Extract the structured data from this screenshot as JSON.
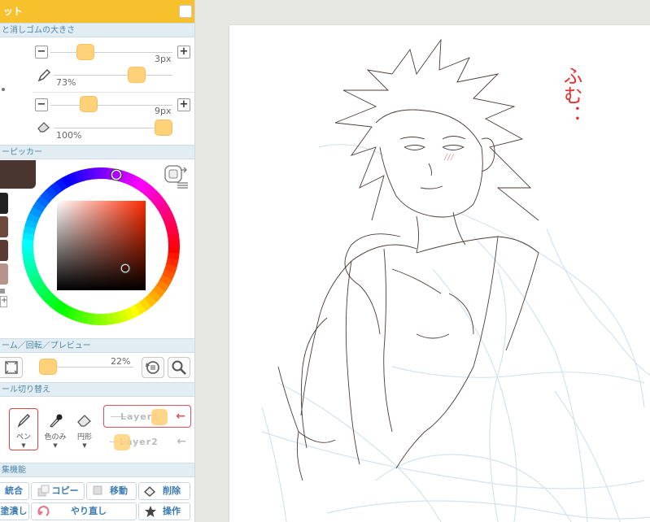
{
  "panel": {
    "title": "ット",
    "sections": {
      "brush": "と消しゴムの大きさ",
      "color": "ーピッカー",
      "zoom": "ーム／回転／プレビュー",
      "tools": "ール切り替え",
      "edit": "集機能"
    },
    "pen": {
      "size_value": "3px",
      "size_level": 0.25,
      "opacity_value": "73%",
      "opacity_level": 0.73
    },
    "eraser": {
      "size_value": "9px",
      "size_level": 0.28,
      "opacity_value": "100%",
      "opacity_level": 1.0
    },
    "zoom": {
      "value": "22%",
      "level": 0.05
    },
    "colors": {
      "current": "#4a3630",
      "swatches": [
        "#222222",
        "#6d4a3c",
        "#5a3a33",
        "#b7938c"
      ]
    },
    "tools": [
      {
        "label": "ペン",
        "icon": "pen-icon",
        "selected": true
      },
      {
        "label": "色のみ",
        "icon": "dropper-icon",
        "selected": false
      },
      {
        "label": "円形",
        "icon": "eraser-icon",
        "selected": false
      }
    ],
    "layers": [
      {
        "name": "Layer1",
        "selected": true
      },
      {
        "name": "Layer2",
        "selected": false
      }
    ],
    "edit": {
      "merge": "統合",
      "copy": "コピー",
      "move": "移動",
      "delete": "削除",
      "fill": "塗潰し",
      "redo": "やり直し",
      "operation": "操作"
    }
  },
  "canvas": {
    "handwriting": "ふむ：",
    "accent_color": "#e53030"
  }
}
